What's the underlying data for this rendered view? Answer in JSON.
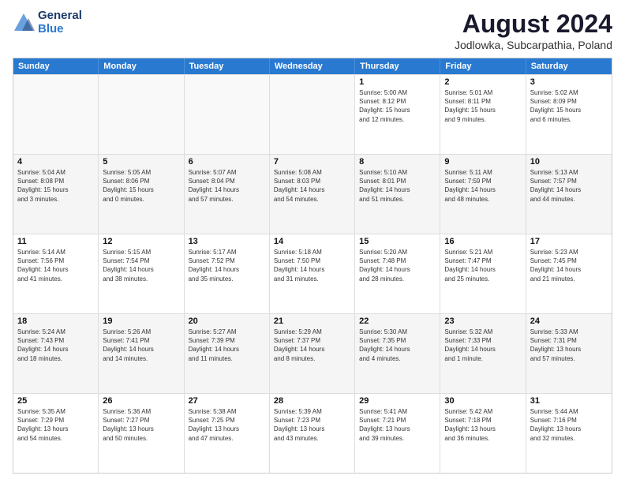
{
  "header": {
    "logo_line1": "General",
    "logo_line2": "Blue",
    "main_title": "August 2024",
    "subtitle": "Jodlowka, Subcarpathia, Poland"
  },
  "days_of_week": [
    "Sunday",
    "Monday",
    "Tuesday",
    "Wednesday",
    "Thursday",
    "Friday",
    "Saturday"
  ],
  "weeks": [
    [
      {
        "day": "",
        "info": "",
        "empty": true
      },
      {
        "day": "",
        "info": "",
        "empty": true
      },
      {
        "day": "",
        "info": "",
        "empty": true
      },
      {
        "day": "",
        "info": "",
        "empty": true
      },
      {
        "day": "1",
        "info": "Sunrise: 5:00 AM\nSunset: 8:12 PM\nDaylight: 15 hours\nand 12 minutes.",
        "empty": false
      },
      {
        "day": "2",
        "info": "Sunrise: 5:01 AM\nSunset: 8:11 PM\nDaylight: 15 hours\nand 9 minutes.",
        "empty": false
      },
      {
        "day": "3",
        "info": "Sunrise: 5:02 AM\nSunset: 8:09 PM\nDaylight: 15 hours\nand 6 minutes.",
        "empty": false
      }
    ],
    [
      {
        "day": "4",
        "info": "Sunrise: 5:04 AM\nSunset: 8:08 PM\nDaylight: 15 hours\nand 3 minutes.",
        "empty": false,
        "shaded": true
      },
      {
        "day": "5",
        "info": "Sunrise: 5:05 AM\nSunset: 8:06 PM\nDaylight: 15 hours\nand 0 minutes.",
        "empty": false,
        "shaded": true
      },
      {
        "day": "6",
        "info": "Sunrise: 5:07 AM\nSunset: 8:04 PM\nDaylight: 14 hours\nand 57 minutes.",
        "empty": false,
        "shaded": true
      },
      {
        "day": "7",
        "info": "Sunrise: 5:08 AM\nSunset: 8:03 PM\nDaylight: 14 hours\nand 54 minutes.",
        "empty": false,
        "shaded": true
      },
      {
        "day": "8",
        "info": "Sunrise: 5:10 AM\nSunset: 8:01 PM\nDaylight: 14 hours\nand 51 minutes.",
        "empty": false,
        "shaded": true
      },
      {
        "day": "9",
        "info": "Sunrise: 5:11 AM\nSunset: 7:59 PM\nDaylight: 14 hours\nand 48 minutes.",
        "empty": false,
        "shaded": true
      },
      {
        "day": "10",
        "info": "Sunrise: 5:13 AM\nSunset: 7:57 PM\nDaylight: 14 hours\nand 44 minutes.",
        "empty": false,
        "shaded": true
      }
    ],
    [
      {
        "day": "11",
        "info": "Sunrise: 5:14 AM\nSunset: 7:56 PM\nDaylight: 14 hours\nand 41 minutes.",
        "empty": false
      },
      {
        "day": "12",
        "info": "Sunrise: 5:15 AM\nSunset: 7:54 PM\nDaylight: 14 hours\nand 38 minutes.",
        "empty": false
      },
      {
        "day": "13",
        "info": "Sunrise: 5:17 AM\nSunset: 7:52 PM\nDaylight: 14 hours\nand 35 minutes.",
        "empty": false
      },
      {
        "day": "14",
        "info": "Sunrise: 5:18 AM\nSunset: 7:50 PM\nDaylight: 14 hours\nand 31 minutes.",
        "empty": false
      },
      {
        "day": "15",
        "info": "Sunrise: 5:20 AM\nSunset: 7:48 PM\nDaylight: 14 hours\nand 28 minutes.",
        "empty": false
      },
      {
        "day": "16",
        "info": "Sunrise: 5:21 AM\nSunset: 7:47 PM\nDaylight: 14 hours\nand 25 minutes.",
        "empty": false
      },
      {
        "day": "17",
        "info": "Sunrise: 5:23 AM\nSunset: 7:45 PM\nDaylight: 14 hours\nand 21 minutes.",
        "empty": false
      }
    ],
    [
      {
        "day": "18",
        "info": "Sunrise: 5:24 AM\nSunset: 7:43 PM\nDaylight: 14 hours\nand 18 minutes.",
        "empty": false,
        "shaded": true
      },
      {
        "day": "19",
        "info": "Sunrise: 5:26 AM\nSunset: 7:41 PM\nDaylight: 14 hours\nand 14 minutes.",
        "empty": false,
        "shaded": true
      },
      {
        "day": "20",
        "info": "Sunrise: 5:27 AM\nSunset: 7:39 PM\nDaylight: 14 hours\nand 11 minutes.",
        "empty": false,
        "shaded": true
      },
      {
        "day": "21",
        "info": "Sunrise: 5:29 AM\nSunset: 7:37 PM\nDaylight: 14 hours\nand 8 minutes.",
        "empty": false,
        "shaded": true
      },
      {
        "day": "22",
        "info": "Sunrise: 5:30 AM\nSunset: 7:35 PM\nDaylight: 14 hours\nand 4 minutes.",
        "empty": false,
        "shaded": true
      },
      {
        "day": "23",
        "info": "Sunrise: 5:32 AM\nSunset: 7:33 PM\nDaylight: 14 hours\nand 1 minute.",
        "empty": false,
        "shaded": true
      },
      {
        "day": "24",
        "info": "Sunrise: 5:33 AM\nSunset: 7:31 PM\nDaylight: 13 hours\nand 57 minutes.",
        "empty": false,
        "shaded": true
      }
    ],
    [
      {
        "day": "25",
        "info": "Sunrise: 5:35 AM\nSunset: 7:29 PM\nDaylight: 13 hours\nand 54 minutes.",
        "empty": false
      },
      {
        "day": "26",
        "info": "Sunrise: 5:36 AM\nSunset: 7:27 PM\nDaylight: 13 hours\nand 50 minutes.",
        "empty": false
      },
      {
        "day": "27",
        "info": "Sunrise: 5:38 AM\nSunset: 7:25 PM\nDaylight: 13 hours\nand 47 minutes.",
        "empty": false
      },
      {
        "day": "28",
        "info": "Sunrise: 5:39 AM\nSunset: 7:23 PM\nDaylight: 13 hours\nand 43 minutes.",
        "empty": false
      },
      {
        "day": "29",
        "info": "Sunrise: 5:41 AM\nSunset: 7:21 PM\nDaylight: 13 hours\nand 39 minutes.",
        "empty": false
      },
      {
        "day": "30",
        "info": "Sunrise: 5:42 AM\nSunset: 7:18 PM\nDaylight: 13 hours\nand 36 minutes.",
        "empty": false
      },
      {
        "day": "31",
        "info": "Sunrise: 5:44 AM\nSunset: 7:16 PM\nDaylight: 13 hours\nand 32 minutes.",
        "empty": false
      }
    ]
  ]
}
